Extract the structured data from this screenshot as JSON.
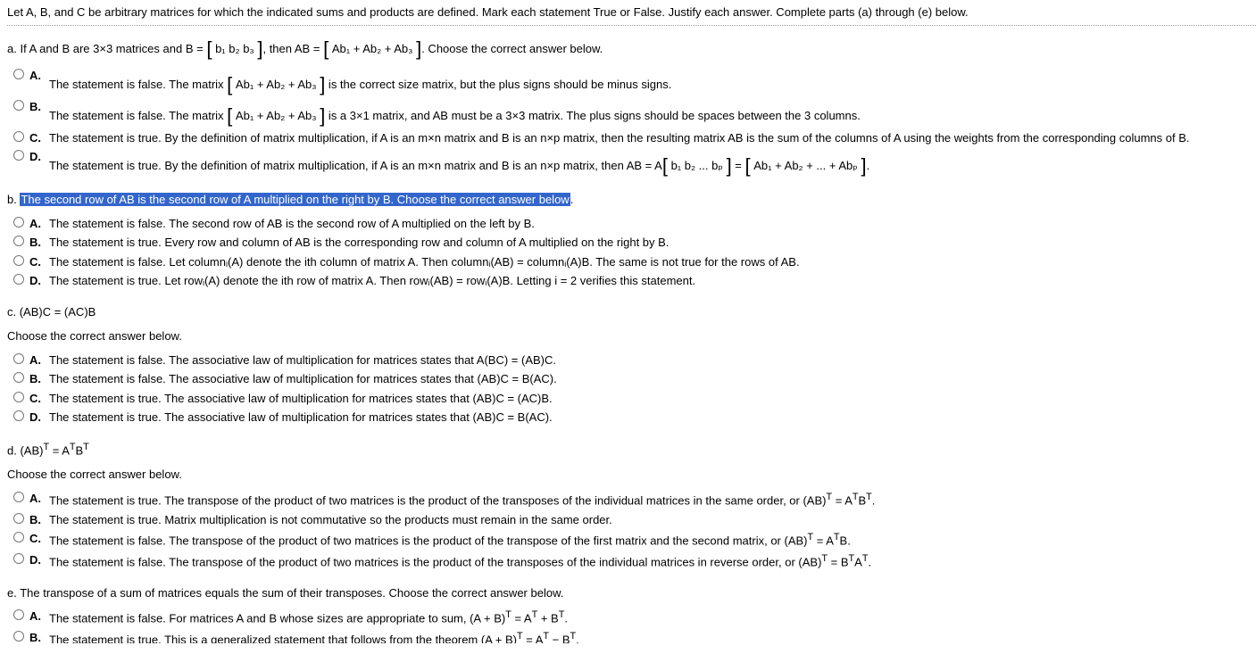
{
  "intro": "Let A, B, and C be arbitrary matrices for which the indicated sums and products are defined. Mark each statement True or False. Justify each answer. Complete parts (a) through (e) below.",
  "qa": {
    "stem_pre": "a. If A and B are 3×3 matrices and B =",
    "stem_mat1": "b₁  b₂  b₃",
    "stem_mid": ", then AB =",
    "stem_mat2": "Ab₁ + Ab₂ + Ab₃",
    "stem_post": ". Choose the correct answer below.",
    "opts": {
      "A": {
        "pre": "The statement is false. The matrix ",
        "mat": "Ab₁ + Ab₂ + Ab₃",
        "post": " is the correct size matrix, but the plus signs should be minus signs."
      },
      "B": {
        "pre": "The statement is false. The matrix ",
        "mat": "Ab₁ + Ab₂ + Ab₃",
        "post": " is a 3×1 matrix, and AB must be a 3×3 matrix. The plus signs should be spaces between the 3 columns."
      },
      "C": "The statement is true. By the definition of matrix multiplication, if A is an m×n matrix and B is an n×p matrix, then the resulting matrix AB is the sum of the columns of A using the weights from the corresponding columns of B.",
      "D": {
        "pre": "The statement is true. By the definition of matrix multiplication, if A is an m×n matrix and B is an n×p matrix, then AB = A",
        "mat1": "b₁  b₂  ...  bₚ",
        "mid": " = ",
        "mat2": "Ab₁ + Ab₂ + ... + Abₚ",
        "post": "."
      }
    }
  },
  "qb": {
    "stem_pre": "b. ",
    "stem_hl": "The second row of AB is the second row of A multiplied on the right by B. Choose the correct answer below",
    "stem_post": ".",
    "opts": {
      "A": "The statement is false. The second row of AB is the second row of A multiplied on the left by B.",
      "B": "The statement is true. Every row and column of AB is the corresponding row and column of A multiplied on the right by B.",
      "C": "The statement is false. Let columnᵢ(A) denote the ith column of matrix A. Then columnᵢ(AB) = columnᵢ(A)B. The same is not true for the rows of AB.",
      "D": "The statement is true. Let rowᵢ(A) denote the ith row of matrix A. Then rowᵢ(AB) = rowᵢ(A)B. Letting i = 2 verifies this statement."
    }
  },
  "qc": {
    "stem": "c. (AB)C = (AC)B",
    "prompt": "Choose the correct answer below.",
    "opts": {
      "A": "The statement is false. The associative law of multiplication for matrices states that A(BC) = (AB)C.",
      "B": "The statement is false. The associative law of multiplication for matrices states that (AB)C = B(AC).",
      "C": "The statement is true. The associative law of multiplication for matrices states that (AB)C = (AC)B.",
      "D": "The statement is true. The associative law of multiplication for matrices states that (AB)C = B(AC)."
    }
  },
  "qd": {
    "stem_html": "d. (AB)<sup>T</sup> = A<sup>T</sup>B<sup>T</sup>",
    "prompt": "Choose the correct answer below.",
    "opts": {
      "A": "The statement is true. The transpose of the product of two matrices is the product of the transposes of the individual matrices in the same order, or (AB)<sup>T</sup> = A<sup>T</sup>B<sup>T</sup>.",
      "B": "The statement is true. Matrix multiplication is not commutative so the products must remain in the same order.",
      "C": "The statement is false. The transpose of the product of two matrices is the product of the transpose of the first matrix and the second matrix, or (AB)<sup>T</sup> = A<sup>T</sup>B.",
      "D": "The statement is false. The transpose of the product of two matrices is the product of the transposes of the individual matrices in reverse order, or (AB)<sup>T</sup> = B<sup>T</sup>A<sup>T</sup>."
    }
  },
  "qe": {
    "stem": "e. The transpose of a sum of matrices equals the sum of their transposes. Choose the correct answer below.",
    "opts": {
      "A": "The statement is false. For matrices A and B whose sizes are appropriate to sum, (A + B)<sup>T</sup> = A<sup>T</sup> + B<sup>T</sup>.",
      "B": "The statement is true. This is a generalized statement that follows from the theorem (A + B)<sup>T</sup> = A<sup>T</sup> − B<sup>T</sup>."
    }
  },
  "letters": {
    "A": "A.",
    "B": "B.",
    "C": "C.",
    "D": "D."
  }
}
